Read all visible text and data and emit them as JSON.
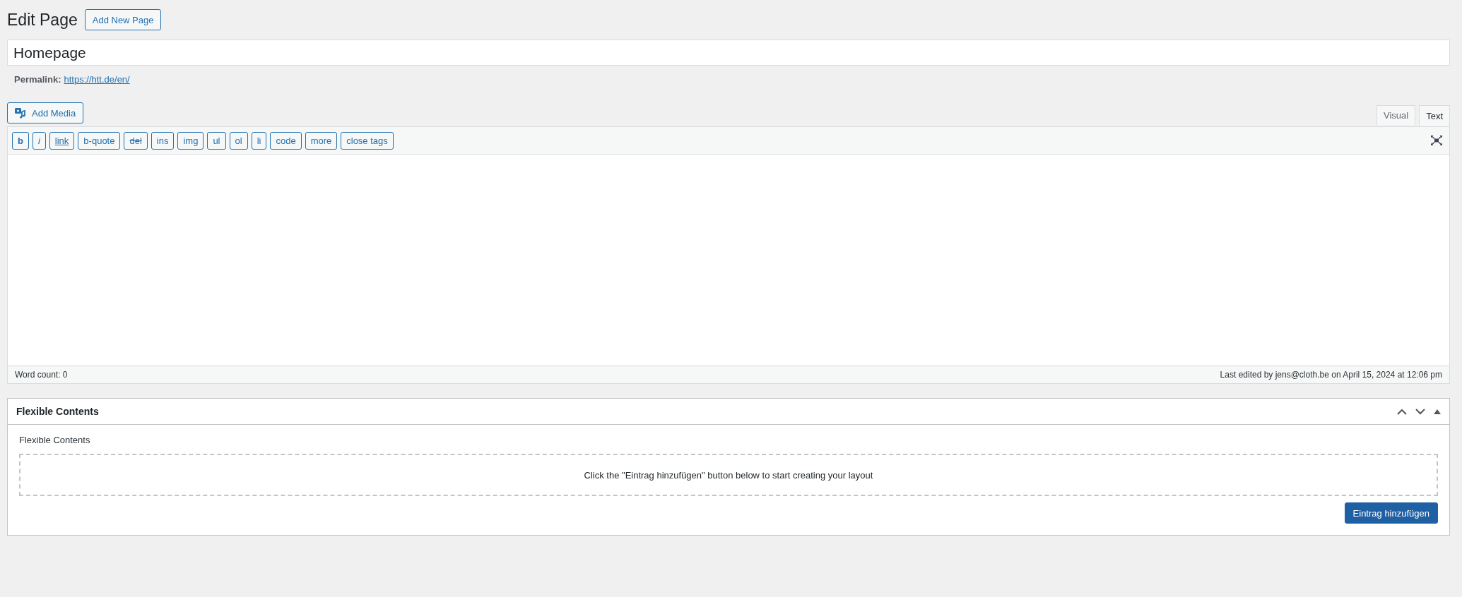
{
  "heading": {
    "title": "Edit Page",
    "add_button": "Add New Page"
  },
  "title_field": {
    "value": "Homepage"
  },
  "permalink": {
    "label": "Permalink:",
    "url": "https://htt.de/en/"
  },
  "add_media": "Add Media",
  "editor_tabs": [
    {
      "label": "Visual",
      "selected": false
    },
    {
      "label": "Text",
      "selected": true
    }
  ],
  "quicktags": [
    {
      "label": "b",
      "kind": "bold"
    },
    {
      "label": "i",
      "kind": "italic"
    },
    {
      "label": "link",
      "kind": "link"
    },
    {
      "label": "b-quote",
      "kind": "plain"
    },
    {
      "label": "del",
      "kind": "strike"
    },
    {
      "label": "ins",
      "kind": "plain"
    },
    {
      "label": "img",
      "kind": "plain"
    },
    {
      "label": "ul",
      "kind": "plain"
    },
    {
      "label": "ol",
      "kind": "plain"
    },
    {
      "label": "li",
      "kind": "plain"
    },
    {
      "label": "code",
      "kind": "plain"
    },
    {
      "label": "more",
      "kind": "plain"
    },
    {
      "label": "close tags",
      "kind": "plain"
    }
  ],
  "status_bar": {
    "word_count": "Word count: 0",
    "last_edited": "Last edited by jens@cloth.be on April 15, 2024 at 12:06 pm"
  },
  "meta_box": {
    "title": "Flexible Contents",
    "field_label": "Flexible Contents",
    "empty_message": "Click the \"Eintrag hinzufügen\" button below to start creating your layout",
    "add_button": "Eintrag hinzufügen"
  }
}
